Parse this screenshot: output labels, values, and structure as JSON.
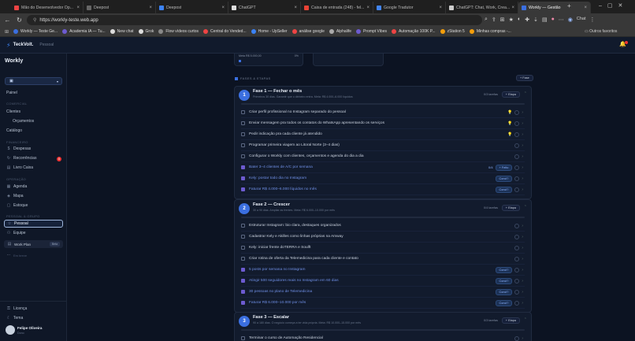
{
  "browser": {
    "tabs": [
      {
        "label": "Mão do Desenvolvedor Op...",
        "color": "#e44"
      },
      {
        "label": "Deepost",
        "color": "#666"
      },
      {
        "label": "Deepost",
        "color": "#3b82f6"
      },
      {
        "label": "ChatGPT",
        "color": "#ddd"
      },
      {
        "label": "Caixa de entrada (248) - fel...",
        "color": "#ea4335"
      },
      {
        "label": "Google Tradutor",
        "color": "#4285f4"
      },
      {
        "label": "ChatGPT: Chat, Work, Crea...",
        "color": "#ccc"
      },
      {
        "label": "Workly — Gestão",
        "color": "#3b6fe0"
      }
    ],
    "url": "https://workly-teste.web.app",
    "chat_label": "Chat",
    "bookmarks": [
      {
        "label": "Workly — Teste Ge...",
        "color": "#3b6fe0"
      },
      {
        "label": "Academia IA — Tu...",
        "color": "#6d5bd0"
      },
      {
        "label": "New chat",
        "color": "#ddd"
      },
      {
        "label": "Grok",
        "color": "#ddd"
      },
      {
        "label": "Flow vídeos curtos",
        "color": "#888"
      },
      {
        "label": "Central do Vended...",
        "color": "#e44"
      },
      {
        "label": "Home - UpSeller",
        "color": "#3b82f6"
      },
      {
        "label": "análise google",
        "color": "#e44"
      },
      {
        "label": "Alphalife",
        "color": "#aaa"
      },
      {
        "label": "Prompt Vibes",
        "color": "#6d5bd0"
      },
      {
        "label": "Automação 100K P...",
        "color": "#e44"
      },
      {
        "label": "zStation 5",
        "color": "#f59e0b"
      },
      {
        "label": "Minhas compras -...",
        "color": "#f59e0b"
      }
    ],
    "other_bookmarks": "Outros favoritos"
  },
  "app": {
    "brand": "TeckVolt.",
    "section": "Pessoal",
    "workspace": "Workly",
    "workspace_switch": "Workly Core",
    "nav": {
      "panel": "Painel",
      "comercial": "COMERCIAL",
      "clientes": "Clientes",
      "orcamentos": "Orçamentos",
      "catalogo": "Catálogo",
      "financeiro": "FINANCEIRO",
      "despesas": "Despesas",
      "recorrencias": "Recorrências",
      "recorrencias_badge": "8",
      "livro_caixa": "Livro Caixa",
      "operacao": "OPERAÇÃO",
      "agenda": "Agenda",
      "mapa": "Mapa",
      "estoque": "Estoque",
      "pessoal_group": "PESSOAL & GRUPO",
      "pessoal": "Pessoal",
      "equipe": "Equipe",
      "work_plan": "Work Plan",
      "work_plan_tag": "Beta",
      "em_breve": "Em breve",
      "licenca": "Licença",
      "tema": "Tema"
    },
    "user": {
      "name": "Felipe Oliveira",
      "role": "Dono"
    }
  },
  "top_widgets": {
    "left_text": "Meta R$ 5.000,00",
    "left_pct": "0%"
  },
  "section_label": "FASES & ETAPAS",
  "add_phase": "+ Fase",
  "phases": [
    {
      "num": "1",
      "title": "Fase 1 — Fechar o mês",
      "sub": "Primeiros 30 dias. Garantir que o dinheiro entra. Meta: R$ 4.000–6.000 líquidos",
      "tasks_count": "0/3 tarefas",
      "add_step": "+ Etapa",
      "tasks": [
        {
          "label": "Criar perfil profissional no Instagram separado do pessoal",
          "bulb": true
        },
        {
          "label": "Enviar mensagem pra todos os contatos do WhatsApp apresentando os serviços",
          "bulb": true
        },
        {
          "label": "Pedir indicação pra cada cliente já atendido",
          "bulb": true
        },
        {
          "label": "Programar primeira viagem ao Litoral Norte (3–4 dias)"
        },
        {
          "label": "Configurar o Workly com clientes, orçamentos e agenda do dia a dia"
        }
      ],
      "goals": [
        {
          "label": "Bater 3–4 clientes de A/C por semana",
          "value": "0/4",
          "action": "+ Feito"
        },
        {
          "label": "Kely: postar todo dia no Instagram",
          "action": "Concl?"
        },
        {
          "label": "Faturar R$ 4.000–6.000 líquidos no mês",
          "action": "Concl?"
        }
      ]
    },
    {
      "num": "2",
      "title": "Fase 2 — Crescer",
      "sub": "30 a 90 dias. Ampliar as frentes. Meta: R$ 6.000–10.000 por mês",
      "tasks_count": "0/4 tarefas",
      "add_step": "+ Etapa",
      "tasks": [
        {
          "label": "Estruturar Instagram: bio clara, destaques organizados"
        },
        {
          "label": "Cadastrar Kely e Akilles como linhas próprias na Amway"
        },
        {
          "label": "Kely: iniciar frente doTERRA e Soulft"
        },
        {
          "label": "Criar rotina de oferta da Telemedicina para cada cliente e contato"
        }
      ],
      "goals": [
        {
          "label": "5 posts por semana no Instagram",
          "action": "Concl?"
        },
        {
          "label": "Atingir 500 seguidores reais no Instagram em 60 dias",
          "action": "Concl?"
        },
        {
          "label": "30 pessoas no plano de Telemedicina",
          "action": "Concl?"
        },
        {
          "label": "Faturar R$ 6.000–10.000 por mês",
          "action": "Concl?"
        }
      ]
    },
    {
      "num": "3",
      "title": "Fase 3 — Escalar",
      "sub": "90 a 180 dias. O negócio começa a ter vida própria. Meta: R$ 10.000–15.000 por mês",
      "tasks_count": "0/3 tarefas",
      "add_step": "+ Etapa",
      "tasks": [
        {
          "label": "Terminar o curso de Automação Residencial"
        }
      ]
    }
  ],
  "colors": {
    "accent": "#3b6fe0",
    "done": "#6d5bd0",
    "bg": "#0c1322"
  }
}
